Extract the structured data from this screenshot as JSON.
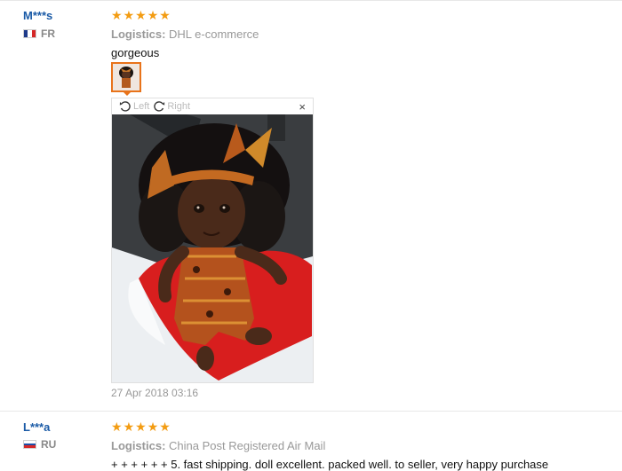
{
  "reviews": [
    {
      "user": "M***s",
      "country": "FR",
      "stars": 5,
      "logistics_label": "Logistics:",
      "logistics_value": "DHL e-commerce",
      "comment": "gorgeous",
      "viewer": {
        "rotate_left_label": "Left",
        "rotate_right_label": "Right",
        "close_label": "×"
      },
      "date": "27 Apr 2018 03:16"
    },
    {
      "user": "L***a",
      "country": "RU",
      "stars": 5,
      "logistics_label": "Logistics:",
      "logistics_value": "China Post Registered Air Mail",
      "comment": "+ + + + + + 5. fast shipping. doll excellent. packed well. to seller, very happy purchase"
    }
  ],
  "colors": {
    "star": "#f39c12",
    "username": "#1a5aa6",
    "thumb_border": "#e8731a"
  },
  "icons": [
    "rotate-left-icon",
    "rotate-right-icon",
    "close-icon",
    "star-icon",
    "flag-fr-icon",
    "flag-ru-icon"
  ]
}
